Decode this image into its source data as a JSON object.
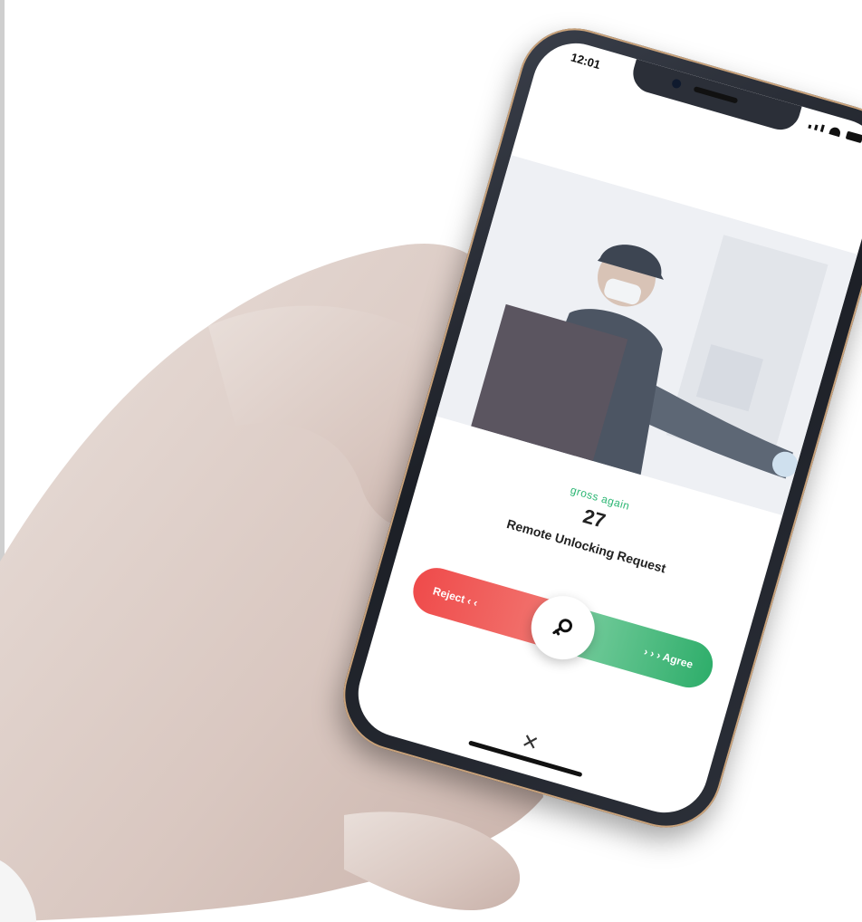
{
  "status_bar": {
    "time": "12:01"
  },
  "unlock_request": {
    "countdown_label": "gross again",
    "countdown_value": "27",
    "title": "Remote Unlocking Request",
    "reject_label": "Reject ‹ ‹",
    "agree_label": "› › › Agree",
    "close_symbol": "✕"
  },
  "icons": {
    "knob": "key-icon",
    "close": "close-icon"
  },
  "colors": {
    "reject": "#ef4b4b",
    "agree": "#2fae6b",
    "countdown_label": "#2bb673"
  }
}
